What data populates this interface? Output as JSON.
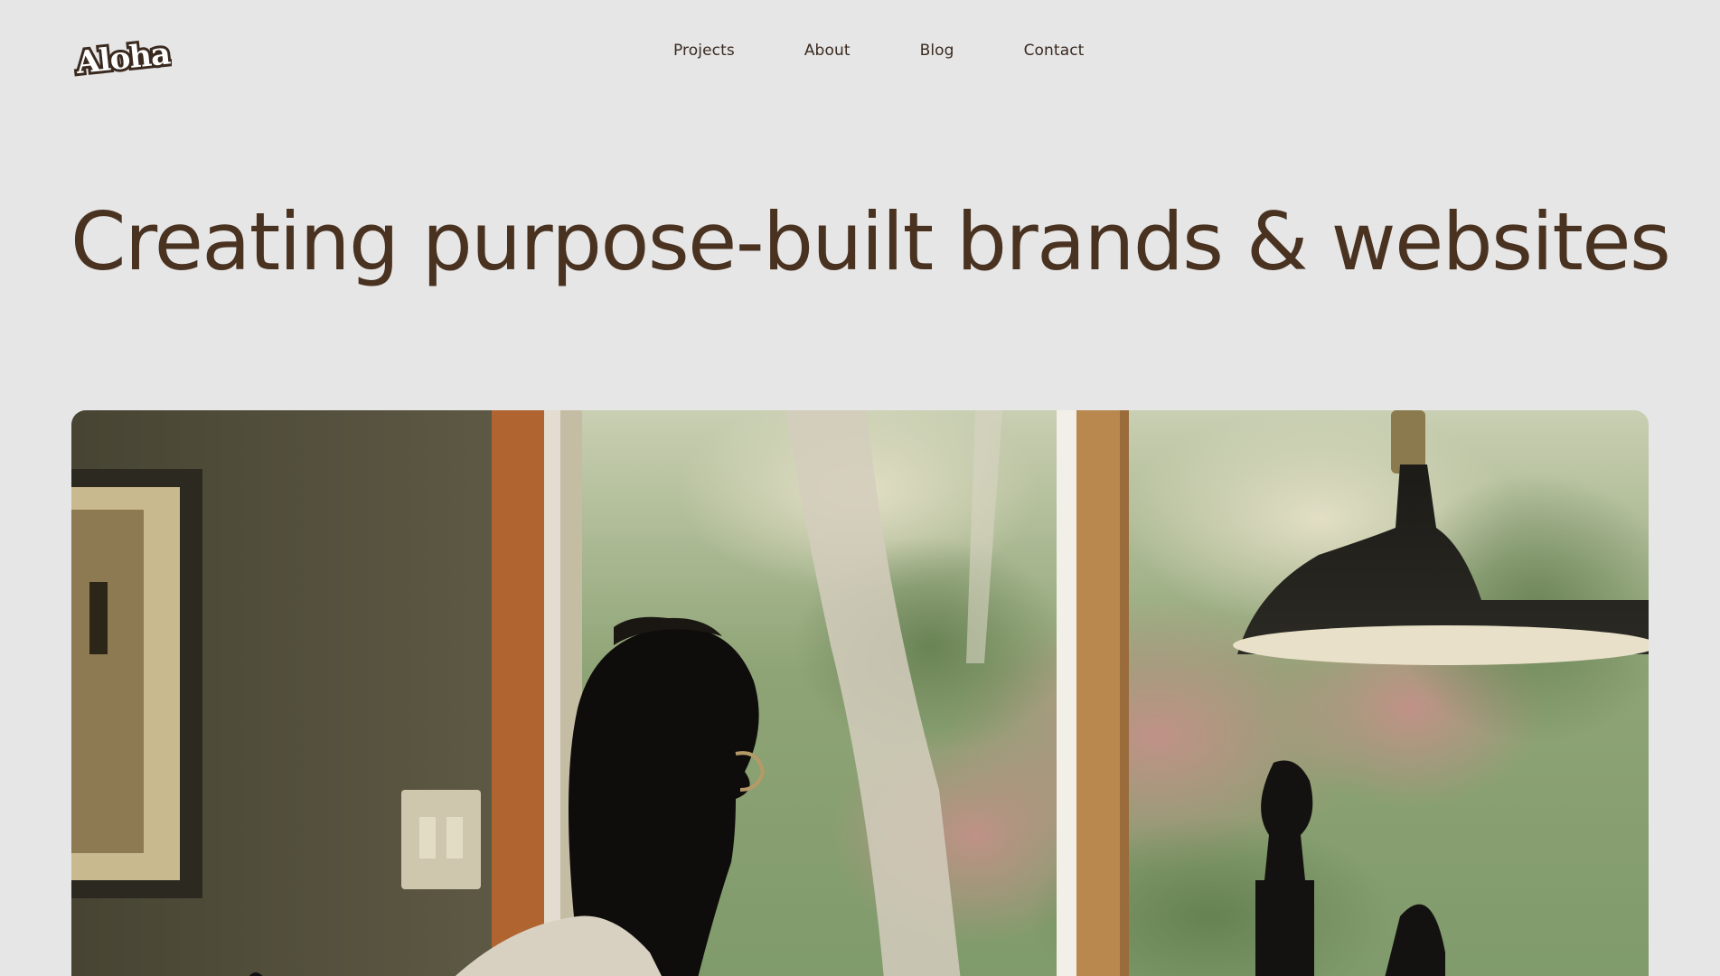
{
  "brand": {
    "logo_text": "Aloha",
    "colors": {
      "background": "#e6e6e6",
      "text": "#4a3221",
      "nav_text": "#3a2a20"
    }
  },
  "nav": {
    "items": [
      {
        "label": "Projects"
      },
      {
        "label": "About"
      },
      {
        "label": "Blog"
      },
      {
        "label": "Contact"
      }
    ]
  },
  "hero": {
    "headline": "Creating purpose-built brands & websites",
    "image_alt": "man at desk by window with lamp"
  }
}
